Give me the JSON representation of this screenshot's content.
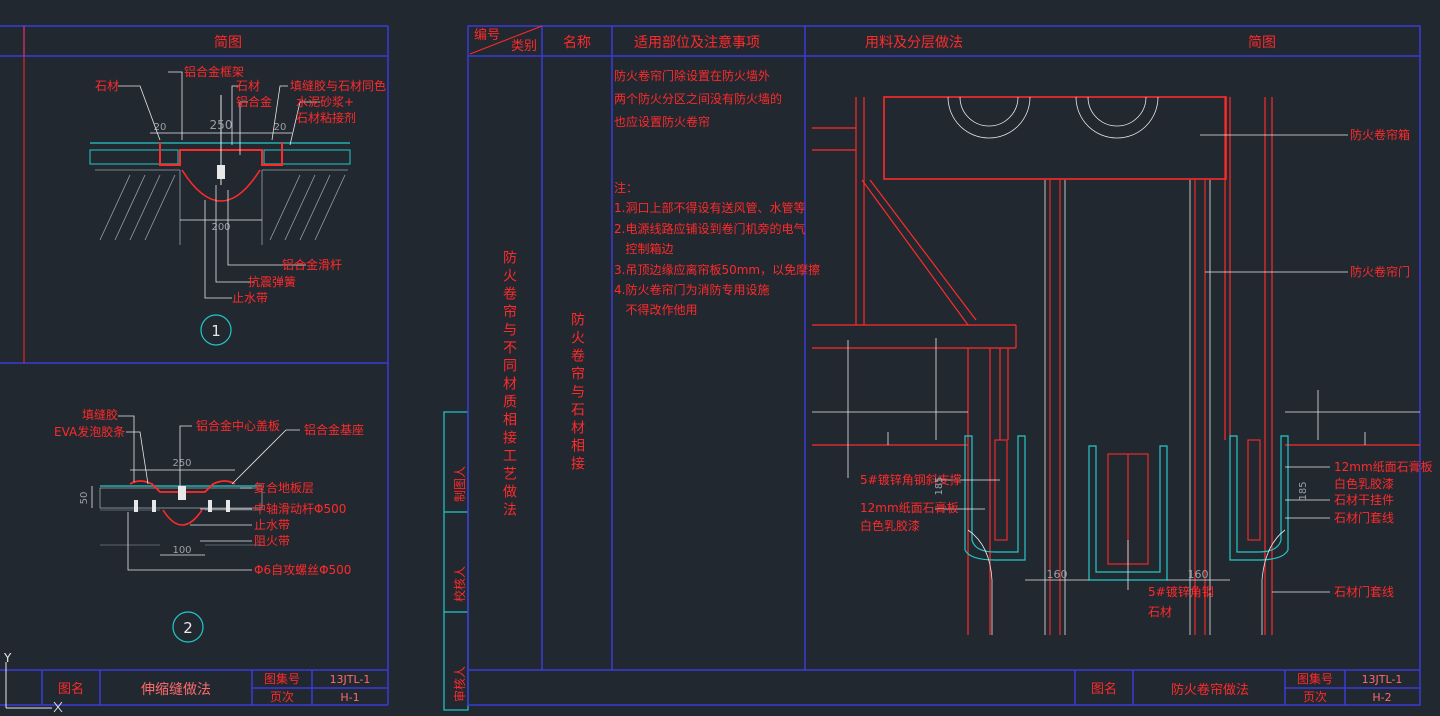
{
  "colors": {
    "background": "#212830",
    "frame": "#3a3ad8",
    "cyan": "#23c8c8",
    "red": "#ff2a2a",
    "white": "#e8e8e8",
    "gray": "#9aa0a8"
  },
  "left_sheet": {
    "header_title": "简图",
    "detail1": {
      "labels": {
        "stone": "石材",
        "al_frame": "铝合金框架",
        "stone2": "石材",
        "al": "铝合金",
        "sealant": "填缝胶与石材同色",
        "mortar": "水泥砂浆+",
        "adhesive": "石材粘接剂",
        "al_rod": "铝合金滑杆",
        "spring": "抗震弹簧",
        "waterstop": "止水带"
      },
      "dims": {
        "left": "20",
        "mid": "250",
        "right": "20",
        "bottom": "200"
      },
      "number": "1"
    },
    "detail2": {
      "labels": {
        "filler": "填缝胶",
        "eva": "EVA发泡胶条",
        "center_cover": "铝合金中心盖板",
        "base": "铝合金基座",
        "composite": "复合地板层",
        "rod": "中轴滑动杆Φ500",
        "waterstop": "止水带",
        "fire": "阻火带",
        "screw": "Φ6自攻螺丝Φ500"
      },
      "dims": {
        "width": "250",
        "height": "50",
        "bottom": "100"
      },
      "number": "2"
    },
    "footer": {
      "name_label": "图名",
      "name_value": "伸缩缝做法",
      "atlas_label": "图集号",
      "atlas_value": "13JTL-1",
      "page_label": "页次",
      "page_value": "H-1"
    }
  },
  "side_strip": {
    "drawn_by": "制图人",
    "checked_by": "校核人",
    "approved_by": "审核人"
  },
  "right_sheet": {
    "headers": {
      "number": "编号",
      "category": "类别",
      "name": "名称",
      "scope": "适用部位及注意事项",
      "materials": "用料及分层做法",
      "diagram": "简图"
    },
    "category_text": "防火卷帘与不同材质相接工艺做法",
    "name_text": "防火卷帘与石材相接",
    "scope_lines": [
      "防火卷帘门除设置在防火墙外",
      "两个防火分区之间没有防火墙的",
      "也应设置防火卷帘",
      "",
      "注：",
      "1.洞口上部不得设有送风管、水管等",
      "2.电源线路应铺设到卷门机旁的电气",
      "   控制箱边",
      "3.吊顶边缘应离帘板50mm，以免摩擦",
      "4.防火卷帘门为消防专用设施",
      "   不得改作他用"
    ],
    "diagram_labels": {
      "box": "防火卷帘箱",
      "door": "防火卷帘门",
      "brace": "5#镀锌角钢斜支撑",
      "gypsum_left_1": "12mm纸面石膏板",
      "gypsum_left_2": "白色乳胶漆",
      "gypsum_right_1": "12mm纸面石膏板",
      "gypsum_right_2": "白色乳胶漆",
      "hanger": "石材干挂件",
      "trim": "石材门套线",
      "trim2": "石材门套线",
      "angle": "5#镀锌角钢",
      "stone": "石材"
    },
    "dims": {
      "left_gap": "160",
      "right_gap": "160",
      "left_h": "185",
      "right_h": "185"
    },
    "footer": {
      "name_label": "图名",
      "name_value": "防火卷帘做法",
      "atlas_label": "图集号",
      "atlas_value": "13JTL-1",
      "page_label": "页次",
      "page_value": "H-2"
    }
  },
  "ucs": {
    "y_axis": "Y"
  }
}
